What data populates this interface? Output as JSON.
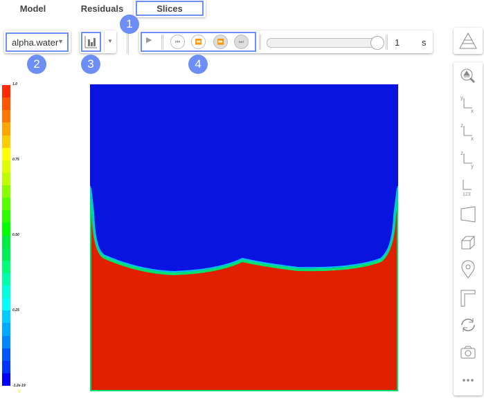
{
  "tabs": [
    {
      "label": "Model"
    },
    {
      "label": "Residuals"
    },
    {
      "label": "Slices",
      "active": true
    }
  ],
  "field_select": {
    "value": "alpha.water"
  },
  "badges": [
    "1",
    "2",
    "3",
    "4"
  ],
  "playback": {
    "buttons": [
      "play",
      "skip-to-start",
      "step-back",
      "step-forward",
      "skip-to-end"
    ],
    "slider_fraction": 1.0,
    "time_value": "1",
    "time_unit": "s"
  },
  "colorbar": {
    "labels": [
      "1.0",
      "0.75",
      "0.50",
      "0.25",
      "-1.2e-19"
    ],
    "colors": [
      "#ff2a00",
      "#ff5500",
      "#ff7700",
      "#ffa500",
      "#ffcc00",
      "#ffff00",
      "#dfff00",
      "#bbff00",
      "#88ff00",
      "#55ff00",
      "#2aff00",
      "#00ff00",
      "#00ee44",
      "#00ee55",
      "#00ff77",
      "#00ffaa",
      "#00ffdd",
      "#00ffff",
      "#00ccff",
      "#00aaff",
      "#0088ff",
      "#0055ff",
      "#0033ff",
      "#0000ff"
    ]
  },
  "colors": {
    "accent": "#6d8ff5",
    "water": "#e02000",
    "air": "#0a14e0"
  },
  "right_toolbar": [
    "layers-icon",
    "zoom-fit-icon",
    "view-xy-icon",
    "view-zx-icon",
    "view-zy-icon",
    "axes-123-icon",
    "perspective-icon",
    "box-icon",
    "pin-icon",
    "ruler-icon",
    "rotate-icon",
    "camera-icon",
    "more-icon"
  ]
}
